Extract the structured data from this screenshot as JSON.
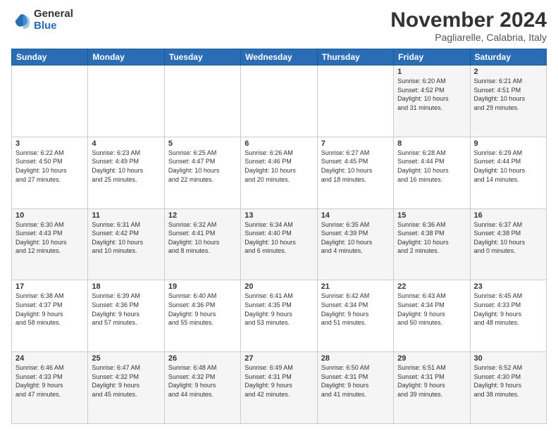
{
  "logo": {
    "general": "General",
    "blue": "Blue"
  },
  "title": "November 2024",
  "location": "Pagliarelle, Calabria, Italy",
  "weekdays": [
    "Sunday",
    "Monday",
    "Tuesday",
    "Wednesday",
    "Thursday",
    "Friday",
    "Saturday"
  ],
  "weeks": [
    [
      {
        "day": "",
        "info": ""
      },
      {
        "day": "",
        "info": ""
      },
      {
        "day": "",
        "info": ""
      },
      {
        "day": "",
        "info": ""
      },
      {
        "day": "",
        "info": ""
      },
      {
        "day": "1",
        "info": "Sunrise: 6:20 AM\nSunset: 4:52 PM\nDaylight: 10 hours\nand 31 minutes."
      },
      {
        "day": "2",
        "info": "Sunrise: 6:21 AM\nSunset: 4:51 PM\nDaylight: 10 hours\nand 29 minutes."
      }
    ],
    [
      {
        "day": "3",
        "info": "Sunrise: 6:22 AM\nSunset: 4:50 PM\nDaylight: 10 hours\nand 27 minutes."
      },
      {
        "day": "4",
        "info": "Sunrise: 6:23 AM\nSunset: 4:49 PM\nDaylight: 10 hours\nand 25 minutes."
      },
      {
        "day": "5",
        "info": "Sunrise: 6:25 AM\nSunset: 4:47 PM\nDaylight: 10 hours\nand 22 minutes."
      },
      {
        "day": "6",
        "info": "Sunrise: 6:26 AM\nSunset: 4:46 PM\nDaylight: 10 hours\nand 20 minutes."
      },
      {
        "day": "7",
        "info": "Sunrise: 6:27 AM\nSunset: 4:45 PM\nDaylight: 10 hours\nand 18 minutes."
      },
      {
        "day": "8",
        "info": "Sunrise: 6:28 AM\nSunset: 4:44 PM\nDaylight: 10 hours\nand 16 minutes."
      },
      {
        "day": "9",
        "info": "Sunrise: 6:29 AM\nSunset: 4:44 PM\nDaylight: 10 hours\nand 14 minutes."
      }
    ],
    [
      {
        "day": "10",
        "info": "Sunrise: 6:30 AM\nSunset: 4:43 PM\nDaylight: 10 hours\nand 12 minutes."
      },
      {
        "day": "11",
        "info": "Sunrise: 6:31 AM\nSunset: 4:42 PM\nDaylight: 10 hours\nand 10 minutes."
      },
      {
        "day": "12",
        "info": "Sunrise: 6:32 AM\nSunset: 4:41 PM\nDaylight: 10 hours\nand 8 minutes."
      },
      {
        "day": "13",
        "info": "Sunrise: 6:34 AM\nSunset: 4:40 PM\nDaylight: 10 hours\nand 6 minutes."
      },
      {
        "day": "14",
        "info": "Sunrise: 6:35 AM\nSunset: 4:39 PM\nDaylight: 10 hours\nand 4 minutes."
      },
      {
        "day": "15",
        "info": "Sunrise: 6:36 AM\nSunset: 4:38 PM\nDaylight: 10 hours\nand 2 minutes."
      },
      {
        "day": "16",
        "info": "Sunrise: 6:37 AM\nSunset: 4:38 PM\nDaylight: 10 hours\nand 0 minutes."
      }
    ],
    [
      {
        "day": "17",
        "info": "Sunrise: 6:38 AM\nSunset: 4:37 PM\nDaylight: 9 hours\nand 58 minutes."
      },
      {
        "day": "18",
        "info": "Sunrise: 6:39 AM\nSunset: 4:36 PM\nDaylight: 9 hours\nand 57 minutes."
      },
      {
        "day": "19",
        "info": "Sunrise: 6:40 AM\nSunset: 4:36 PM\nDaylight: 9 hours\nand 55 minutes."
      },
      {
        "day": "20",
        "info": "Sunrise: 6:41 AM\nSunset: 4:35 PM\nDaylight: 9 hours\nand 53 minutes."
      },
      {
        "day": "21",
        "info": "Sunrise: 6:42 AM\nSunset: 4:34 PM\nDaylight: 9 hours\nand 51 minutes."
      },
      {
        "day": "22",
        "info": "Sunrise: 6:43 AM\nSunset: 4:34 PM\nDaylight: 9 hours\nand 50 minutes."
      },
      {
        "day": "23",
        "info": "Sunrise: 6:45 AM\nSunset: 4:33 PM\nDaylight: 9 hours\nand 48 minutes."
      }
    ],
    [
      {
        "day": "24",
        "info": "Sunrise: 6:46 AM\nSunset: 4:33 PM\nDaylight: 9 hours\nand 47 minutes."
      },
      {
        "day": "25",
        "info": "Sunrise: 6:47 AM\nSunset: 4:32 PM\nDaylight: 9 hours\nand 45 minutes."
      },
      {
        "day": "26",
        "info": "Sunrise: 6:48 AM\nSunset: 4:32 PM\nDaylight: 9 hours\nand 44 minutes."
      },
      {
        "day": "27",
        "info": "Sunrise: 6:49 AM\nSunset: 4:31 PM\nDaylight: 9 hours\nand 42 minutes."
      },
      {
        "day": "28",
        "info": "Sunrise: 6:50 AM\nSunset: 4:31 PM\nDaylight: 9 hours\nand 41 minutes."
      },
      {
        "day": "29",
        "info": "Sunrise: 6:51 AM\nSunset: 4:31 PM\nDaylight: 9 hours\nand 39 minutes."
      },
      {
        "day": "30",
        "info": "Sunrise: 6:52 AM\nSunset: 4:30 PM\nDaylight: 9 hours\nand 38 minutes."
      }
    ]
  ]
}
